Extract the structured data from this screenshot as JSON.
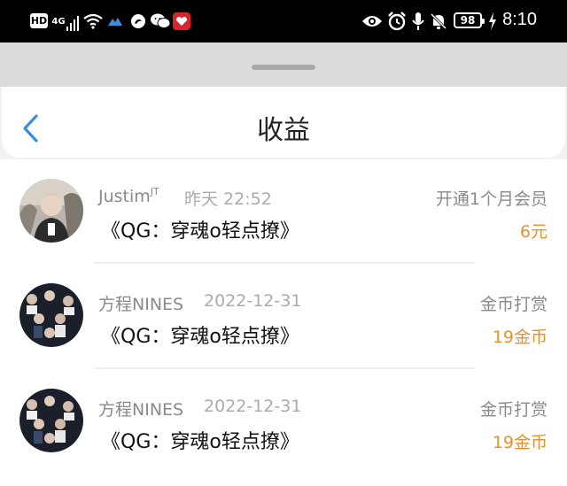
{
  "status_bar": {
    "hd": "HD",
    "network": "4G",
    "battery": "98",
    "time": "8:10"
  },
  "header": {
    "title": "收益"
  },
  "earnings": [
    {
      "user": "Justim",
      "user_sup": "JT",
      "time": "昨天 22:52",
      "book": "《QG：穿魂o轻点撩》",
      "type": "开通1个月会员",
      "amount": "6元"
    },
    {
      "user": "方程NINES",
      "user_sup": "",
      "time": "2022-12-31",
      "book": "《QG：穿魂o轻点撩》",
      "type": "金币打赏",
      "amount": "19金币"
    },
    {
      "user": "方程NINES",
      "user_sup": "",
      "time": "2022-12-31",
      "book": "《QG：穿魂o轻点撩》",
      "type": "金币打赏",
      "amount": "19金币"
    }
  ],
  "colors": {
    "accent": "#3a8fd6",
    "amount": "#e8902e"
  }
}
